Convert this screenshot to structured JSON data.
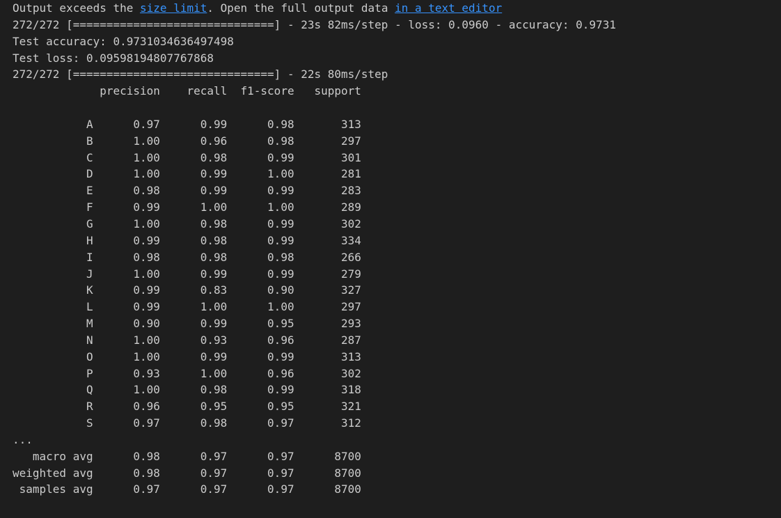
{
  "notice": {
    "prefix": "Output exceeds the ",
    "link1": "size limit",
    "middle": ". Open the full output data ",
    "link2": "in a text editor"
  },
  "log": {
    "eval_progress": "272/272 [==============================] - 23s 82ms/step - loss: 0.0960 - accuracy: 0.9731",
    "test_accuracy": "Test accuracy: 0.9731034636497498",
    "test_loss": "Test loss: 0.09598194807767868",
    "predict_progress": "272/272 [==============================] - 22s 80ms/step"
  },
  "report": {
    "header": [
      "precision",
      "recall",
      "f1-score",
      "support"
    ],
    "rows": [
      {
        "label": "A",
        "precision": "0.97",
        "recall": "0.99",
        "f1": "0.98",
        "support": "313"
      },
      {
        "label": "B",
        "precision": "1.00",
        "recall": "0.96",
        "f1": "0.98",
        "support": "297"
      },
      {
        "label": "C",
        "precision": "1.00",
        "recall": "0.98",
        "f1": "0.99",
        "support": "301"
      },
      {
        "label": "D",
        "precision": "1.00",
        "recall": "0.99",
        "f1": "1.00",
        "support": "281"
      },
      {
        "label": "E",
        "precision": "0.98",
        "recall": "0.99",
        "f1": "0.99",
        "support": "283"
      },
      {
        "label": "F",
        "precision": "0.99",
        "recall": "1.00",
        "f1": "1.00",
        "support": "289"
      },
      {
        "label": "G",
        "precision": "1.00",
        "recall": "0.98",
        "f1": "0.99",
        "support": "302"
      },
      {
        "label": "H",
        "precision": "0.99",
        "recall": "0.98",
        "f1": "0.99",
        "support": "334"
      },
      {
        "label": "I",
        "precision": "0.98",
        "recall": "0.98",
        "f1": "0.98",
        "support": "266"
      },
      {
        "label": "J",
        "precision": "1.00",
        "recall": "0.99",
        "f1": "0.99",
        "support": "279"
      },
      {
        "label": "K",
        "precision": "0.99",
        "recall": "0.83",
        "f1": "0.90",
        "support": "327"
      },
      {
        "label": "L",
        "precision": "0.99",
        "recall": "1.00",
        "f1": "1.00",
        "support": "297"
      },
      {
        "label": "M",
        "precision": "0.90",
        "recall": "0.99",
        "f1": "0.95",
        "support": "293"
      },
      {
        "label": "N",
        "precision": "1.00",
        "recall": "0.93",
        "f1": "0.96",
        "support": "287"
      },
      {
        "label": "O",
        "precision": "1.00",
        "recall": "0.99",
        "f1": "0.99",
        "support": "313"
      },
      {
        "label": "P",
        "precision": "0.93",
        "recall": "1.00",
        "f1": "0.96",
        "support": "302"
      },
      {
        "label": "Q",
        "precision": "1.00",
        "recall": "0.98",
        "f1": "0.99",
        "support": "318"
      },
      {
        "label": "R",
        "precision": "0.96",
        "recall": "0.95",
        "f1": "0.95",
        "support": "321"
      },
      {
        "label": "S",
        "precision": "0.97",
        "recall": "0.98",
        "f1": "0.97",
        "support": "312"
      }
    ],
    "ellipsis": "...",
    "averages": [
      {
        "label": "macro avg",
        "precision": "0.98",
        "recall": "0.97",
        "f1": "0.97",
        "support": "8700"
      },
      {
        "label": "weighted avg",
        "precision": "0.98",
        "recall": "0.97",
        "f1": "0.97",
        "support": "8700"
      },
      {
        "label": "samples avg",
        "precision": "0.97",
        "recall": "0.97",
        "f1": "0.97",
        "support": "8700"
      }
    ]
  },
  "colors": {
    "background": "#1e1e1e",
    "text": "#cccccc",
    "link": "#3794ff"
  }
}
